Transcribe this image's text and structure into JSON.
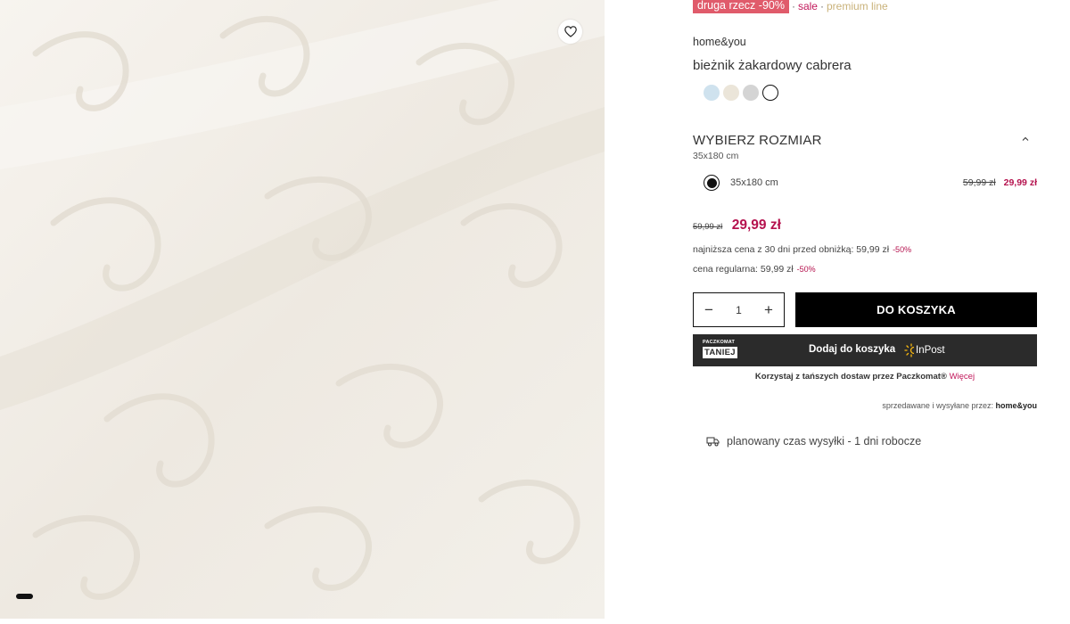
{
  "product": {
    "badges": {
      "promo": "druga rzecz -90%",
      "separator": "·",
      "sale": "sale",
      "premium": "premium line"
    },
    "brand": "home&you",
    "title": "bieżnik żakardowy cabrera",
    "swatches": [
      {
        "color": "#cfe2ee",
        "active": false
      },
      {
        "color": "#ebe5d9",
        "active": false
      },
      {
        "color": "#d4d4d4",
        "active": false
      },
      {
        "color": "#ffffff",
        "active": true
      }
    ]
  },
  "size": {
    "heading": "WYBIERZ ROZMIAR",
    "selected": "35x180 cm",
    "options": [
      {
        "label": "35x180 cm",
        "old_price": "59,99 zł",
        "new_price": "29,99 zł"
      }
    ]
  },
  "price": {
    "old": "59,99 zł",
    "current": "29,99 zł",
    "lowest_label": "najniższa cena z 30 dni przed obniżką: 59,99 zł",
    "lowest_pct": "-50%",
    "regular_label": "cena regularna: 59,99 zł",
    "regular_pct": "-50%"
  },
  "cart": {
    "quantity": "1",
    "minus": "−",
    "plus": "+",
    "add_label": "DO KOSZYKA"
  },
  "inpost": {
    "badge_top": "PACZKOMAT",
    "badge_bottom": "TANIEJ",
    "button_label": "Dodaj do koszyka",
    "logo_text": "InPost",
    "note": "Korzystaj z tańszych dostaw przez Paczkomat®",
    "note_link": "Więcej"
  },
  "seller": {
    "prefix": "sprzedawane i wysyłane przez:",
    "name": "home&you"
  },
  "shipping": {
    "text": "planowany czas wysyłki - 1 dni robocze"
  },
  "icons": {
    "favorite": "heart-icon",
    "collapse": "chevron-up-icon",
    "shipping": "truck-icon",
    "inpost": "inpost-sun-icon"
  },
  "colors": {
    "promo_badge": "#e05b6b",
    "sale_price": "#b5124e",
    "link": "#c2185b",
    "premium": "#c9b27a"
  }
}
